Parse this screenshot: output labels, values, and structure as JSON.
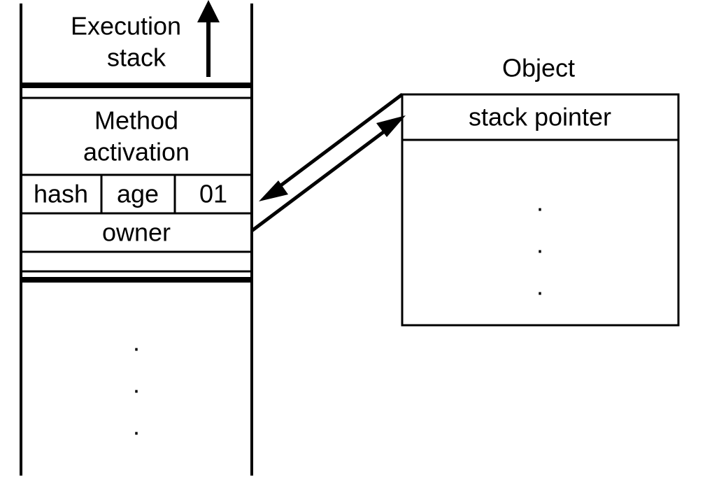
{
  "stack": {
    "title_line1": "Execution",
    "title_line2": "stack",
    "method_line1": "Method",
    "method_line2": "activation",
    "header_cells": [
      "hash",
      "age",
      "01"
    ],
    "owner": "owner",
    "ellipsis": [
      "·",
      "·",
      "·"
    ]
  },
  "object": {
    "title": "Object",
    "pointer_label": "stack pointer",
    "ellipsis": [
      "·",
      "·",
      "·"
    ]
  }
}
